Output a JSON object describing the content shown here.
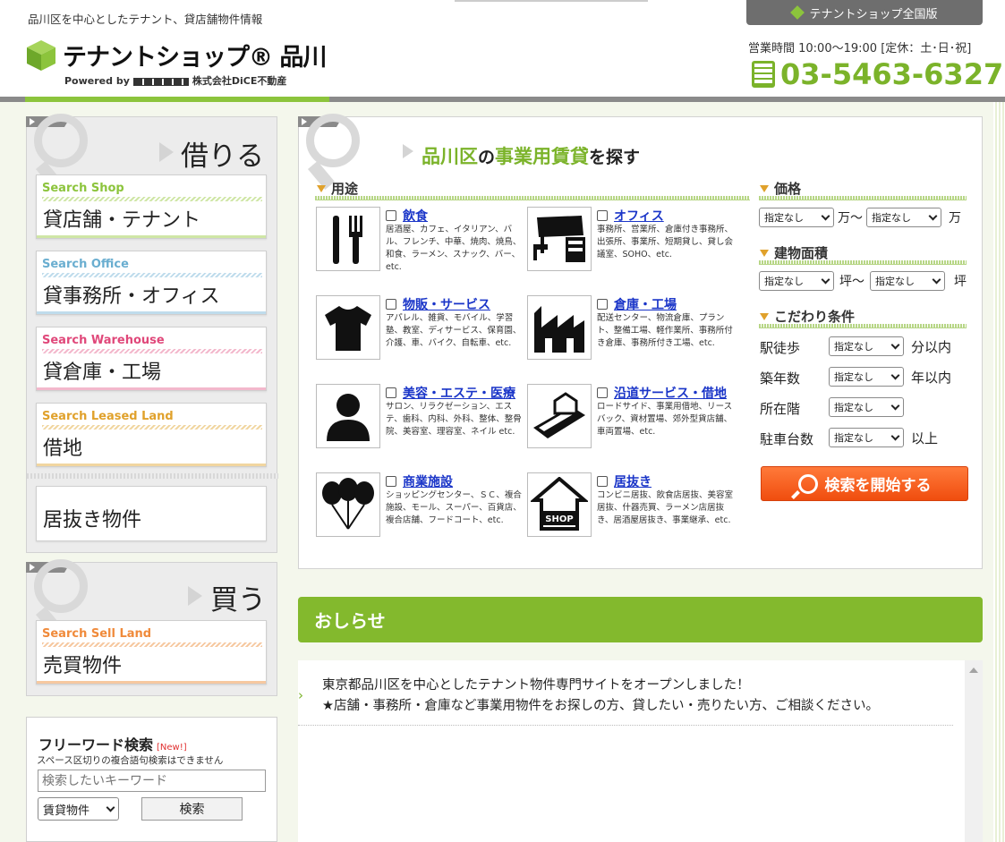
{
  "header": {
    "tagline": "品川区を中心としたテナント、貸店舗物件情報",
    "logo_text": "テナントショップ® 品川",
    "powered_by": "Powered by",
    "company": "株式会社DiCE不動産",
    "national_tab": "テナントショップ全国版",
    "hours": "営業時間 10:00〜19:00 [定休：土･日･祝]",
    "phone": "03-5463-6327"
  },
  "rent_panel": {
    "heading": "借りる",
    "items": [
      {
        "sub": "Search Shop",
        "label": "貸店舗・テナント",
        "color": "#8cc43c",
        "bar": "#cfe6a6"
      },
      {
        "sub": "Search Office",
        "label": "貸事務所・オフィス",
        "color": "#6aaed0",
        "bar": "#bfdcec"
      },
      {
        "sub": "Search Warehouse",
        "label": "貸倉庫・工場",
        "color": "#e0487a",
        "bar": "#f3b8cc"
      },
      {
        "sub": "Search Leased Land",
        "label": "借地",
        "color": "#e0a12b",
        "bar": "#f1d6a0"
      }
    ],
    "inuki": "居抜き物件"
  },
  "buy_panel": {
    "heading": "買う",
    "items": [
      {
        "sub": "Search Sell Land",
        "label": "売買物件",
        "color": "#f08a3a",
        "bar": "#f6c8a0"
      }
    ]
  },
  "search_panel": {
    "title_pre": "品川区",
    "title_no": "の",
    "title_main": "事業用賃貸",
    "title_post": "を探す",
    "usage_head": "用途",
    "categories": [
      {
        "title": "飲食",
        "desc": "居酒屋、カフェ、イタリアン、バル、フレンチ、中華、焼肉、焼鳥、和食、ラーメン、スナック、バー、etc.",
        "icon": "fork-knife-icon"
      },
      {
        "title": "オフィス",
        "desc": "事務所、営業所、倉庫付き事務所、出張所、事業所、短期貸し、貸し会議室、SOHO、etc.",
        "icon": "office-desk-icon"
      },
      {
        "title": "物販・サービス",
        "desc": "アパレル、雑貨、モバイル、学習塾、教室、ディサービス、保育園、介護、車、バイク、自転車、etc.",
        "icon": "tshirt-icon"
      },
      {
        "title": "倉庫・工場",
        "desc": "配送センター、物流倉庫、プラント、整備工場、軽作業所、事務所付き倉庫、事務所付き工場、etc.",
        "icon": "factory-icon"
      },
      {
        "title": "美容・エステ・医療",
        "desc": "サロン、リラクゼーション、エステ、歯科、内科、外科、整体、整骨院、美容室、理容室、ネイル etc.",
        "icon": "person-icon"
      },
      {
        "title": "沿道サービス・借地",
        "desc": "ロードサイド、事業用借地、リースバック、資材置場、郊外型貨店舗、車両置場、etc.",
        "icon": "roadside-land-icon"
      },
      {
        "title": "商業施設",
        "desc": "ショッピングセンター、ＳＣ、複合施設、モール、スーパー、百貨店、複合店舗、フードコート、etc.",
        "icon": "balloons-icon"
      },
      {
        "title": "居抜き",
        "desc": "コンビニ居抜、飲食店居抜、美容室居抜、什器売買、ラーメン店居抜き、居酒屋居抜き、事業継承、etc.",
        "icon": "shop-house-icon"
      }
    ],
    "price_head": "価格",
    "price_unit_mid": "万〜",
    "price_unit_end": "万",
    "area_head": "建物面積",
    "area_unit_mid": "坪〜",
    "area_unit_end": "坪",
    "cond_head": "こだわり条件",
    "select_default": "指定なし",
    "conditions": [
      {
        "label": "駅徒歩",
        "suffix": "分以内"
      },
      {
        "label": "築年数",
        "suffix": "年以内"
      },
      {
        "label": "所在階",
        "suffix": ""
      },
      {
        "label": "駐車台数",
        "suffix": "以上"
      }
    ],
    "start_button": "検索を開始する"
  },
  "news": {
    "head": "おしらせ",
    "lines": [
      "東京都品川区を中心としたテナント物件専門サイトをオープンしました！",
      "★店舗・事務所・倉庫など事業用物件をお探しの方、貸したい・売りたい方、ご相談ください。"
    ]
  },
  "freeword": {
    "title": "フリーワード検索",
    "new_badge": "[New!]",
    "note": "スペース区切りの複合語句検索はできません",
    "placeholder": "検索したいキーワード",
    "select_value": "賃貸物件",
    "button": "検索"
  },
  "colors": {
    "brand_green": "#7bb32a",
    "accent_orange": "#f04d0e"
  }
}
